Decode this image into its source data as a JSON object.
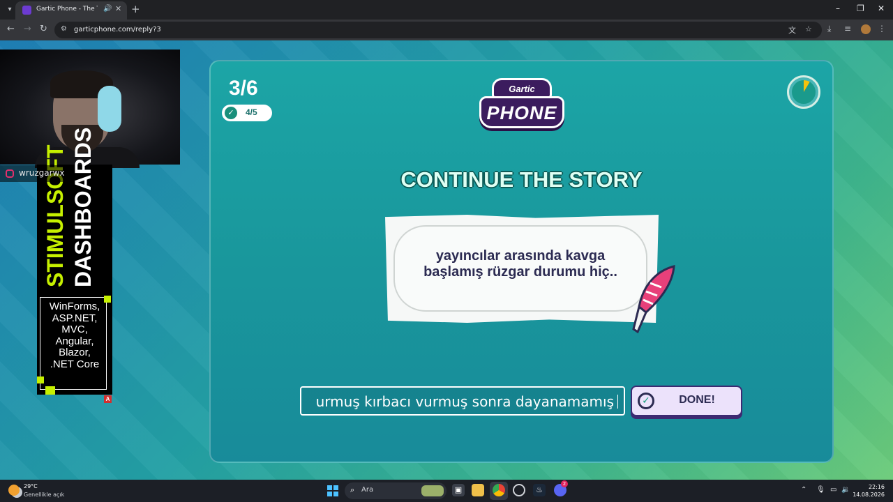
{
  "browser": {
    "tab_title": "Gartic Phone - The Telephone Game",
    "new_tab": "+",
    "url": "garticphone.com/reply?3",
    "window_controls": [
      "–",
      "❐",
      "✕"
    ]
  },
  "game": {
    "round": "3/6",
    "players_done": "4/5",
    "logo_top": "Gartic",
    "logo_bottom": "PHONE",
    "heading": "CONTINUE THE STORY",
    "prompt_line1": "yayıncılar arasında kavga",
    "prompt_line2": "başlamış rüzgar durumu hiç..",
    "input_value": "urmuş kırbacı vurmuş sonra dayanamamış",
    "done_label": "DONE!",
    "accent_color": "#3d2a72",
    "timer_color": "#f4c20d"
  },
  "overlay": {
    "instagram_handle": "wruzgarwx",
    "ad_line1": "STIMULSOFT",
    "ad_line2": "DASHBOARDS",
    "ad_techs": [
      "WinForms,",
      "ASP.NET,",
      "MVC,",
      "Angular,",
      "Blazor,",
      ".NET Core"
    ],
    "ad_tag": "A",
    "ad_accent": "#c6f000"
  },
  "taskbar": {
    "temperature": "29°C",
    "weather": "Genellikle açık",
    "search_placeholder": "Ara",
    "time": "22:16",
    "date": "14.08.2026",
    "discord_badge": "2"
  }
}
